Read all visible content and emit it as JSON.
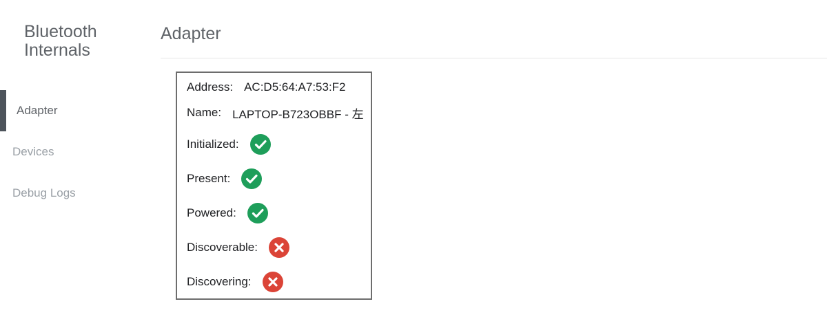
{
  "sidebar": {
    "title_line1": "Bluetooth",
    "title_line2": "Internals",
    "items": [
      {
        "label": "Adapter",
        "selected": true
      },
      {
        "label": "Devices",
        "selected": false
      },
      {
        "label": "Debug Logs",
        "selected": false
      }
    ]
  },
  "main": {
    "title": "Adapter"
  },
  "adapter": {
    "address_label": "Address:",
    "address_value": "AC:D5:64:A7:53:F2",
    "name_label": "Name:",
    "name_value": "LAPTOP-B723OBBF - 左",
    "initialized_label": "Initialized:",
    "initialized": true,
    "present_label": "Present:",
    "present": true,
    "powered_label": "Powered:",
    "powered": true,
    "discoverable_label": "Discoverable:",
    "discoverable": false,
    "discovering_label": "Discovering:",
    "discovering": false
  },
  "colors": {
    "success": "#1e9e5a",
    "error": "#db4437",
    "nav_selected_bar": "#4d535b"
  },
  "icons": {
    "success": "check-circle-icon",
    "error": "x-circle-icon"
  }
}
